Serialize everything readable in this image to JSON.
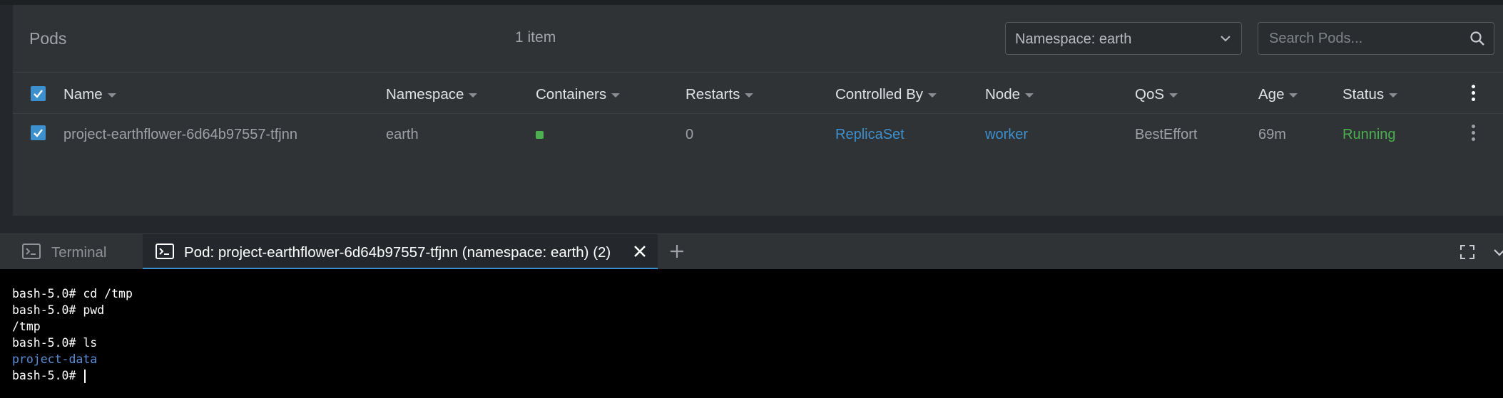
{
  "pods_panel": {
    "title": "Pods",
    "items_count": "1 item",
    "namespace_select": {
      "value": "Namespace: earth"
    },
    "search": {
      "placeholder": "Search Pods..."
    },
    "columns": [
      "Name",
      "Namespace",
      "Containers",
      "Restarts",
      "Controlled By",
      "Node",
      "QoS",
      "Age",
      "Status"
    ],
    "rows": [
      {
        "name": "project-earthflower-6d64b97557-tfjnn",
        "namespace": "earth",
        "containers_status": "running",
        "restarts": "0",
        "controlled_by": "ReplicaSet",
        "node": "worker",
        "qos": "BestEffort",
        "age": "69m",
        "status": "Running",
        "selected": true
      }
    ]
  },
  "dock": {
    "tabs": [
      {
        "label": "Terminal",
        "active": false
      },
      {
        "label": "Pod: project-earthflower-6d64b97557-tfjnn (namespace: earth) (2)",
        "active": true
      }
    ]
  },
  "terminal": {
    "lines": [
      {
        "text": "bash-5.0# cd /tmp",
        "type": "cmd"
      },
      {
        "text": "bash-5.0# pwd",
        "type": "cmd"
      },
      {
        "text": "/tmp",
        "type": "out"
      },
      {
        "text": "bash-5.0# ls",
        "type": "cmd"
      },
      {
        "text": "project-data",
        "type": "dir"
      },
      {
        "text": "bash-5.0# ",
        "type": "prompt"
      }
    ]
  },
  "colors": {
    "accent": "#3d90ce",
    "success": "#4caf50",
    "panel_bg": "#2f3336",
    "terminal_bg": "#000000"
  }
}
